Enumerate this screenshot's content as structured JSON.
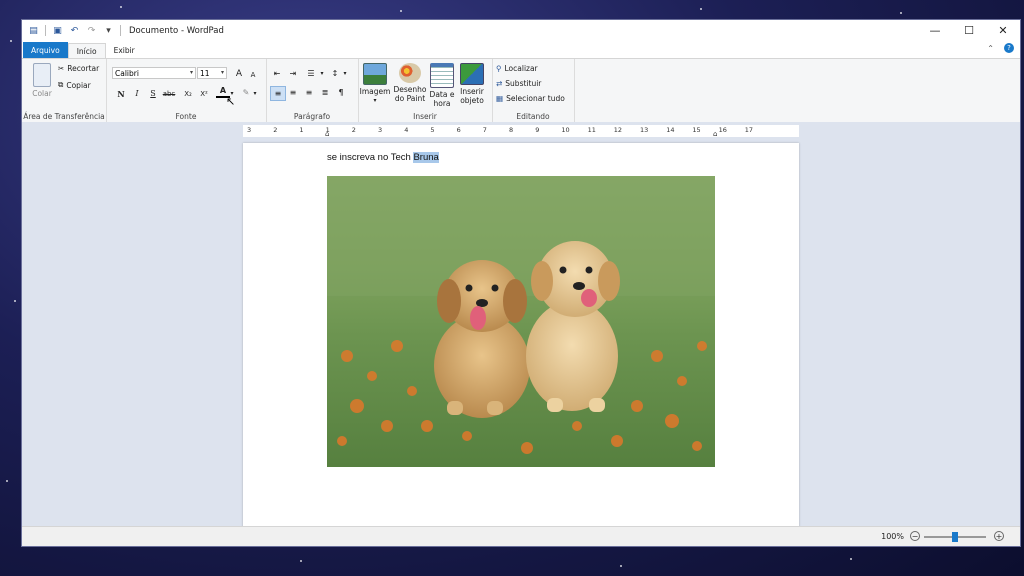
{
  "window": {
    "title": "Documento - WordPad"
  },
  "tabs": {
    "file": "Arquivo",
    "home": "Início",
    "view": "Exibir"
  },
  "clipboard": {
    "paste": "Colar",
    "cut": "Recortar",
    "copy": "Copiar",
    "label": "Área de Transferência"
  },
  "font": {
    "family": "Calibri",
    "size": "11",
    "bold": "N",
    "italic": "I",
    "underline": "S",
    "strike": "abc",
    "subscript": "X₂",
    "superscript": "X²",
    "color_glyph": "A",
    "grow": "A",
    "shrink": "A",
    "label": "Fonte"
  },
  "paragraph": {
    "label": "Parágrafo"
  },
  "insert": {
    "image": "Imagem",
    "paint": "Desenho do Paint",
    "datetime": "Data e hora",
    "object": "Inserir objeto",
    "label": "Inserir"
  },
  "editing": {
    "find": "Localizar",
    "replace": "Substituir",
    "select_all": "Selecionar tudo",
    "label": "Editando"
  },
  "ruler": {
    "labels": [
      "3",
      "2",
      "1",
      "1",
      "2",
      "3",
      "4",
      "5",
      "6",
      "7",
      "8",
      "9",
      "10",
      "11",
      "12",
      "13",
      "14",
      "15",
      "16",
      "17"
    ]
  },
  "document": {
    "text_before": "se inscreva no Tech ",
    "text_selected": "Bruna"
  },
  "status": {
    "zoom": "100%",
    "zoom_level_percent": 100
  },
  "colors": {
    "accent": "#1979ca",
    "selection": "#a8c8ea"
  }
}
